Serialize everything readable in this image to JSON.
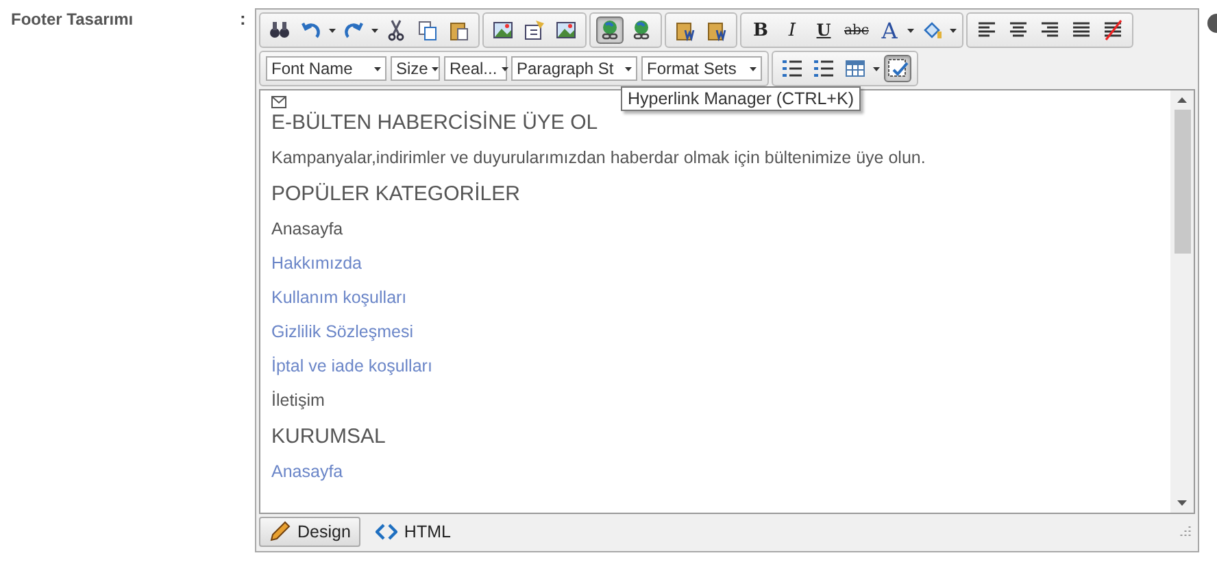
{
  "field_label": "Footer Tasarımı",
  "separator": ":",
  "toolbar_row1": [
    {
      "buttons": [
        {
          "kind": "find",
          "active": false
        },
        {
          "kind": "undo",
          "active": false
        },
        {
          "kind": "caret"
        },
        {
          "kind": "redo",
          "active": false
        },
        {
          "kind": "caret"
        },
        {
          "kind": "cut",
          "active": false
        },
        {
          "kind": "copy",
          "active": false
        },
        {
          "kind": "paste",
          "active": false
        }
      ]
    },
    {
      "buttons": [
        {
          "kind": "image",
          "active": false
        },
        {
          "kind": "properties",
          "active": false
        },
        {
          "kind": "image-map",
          "active": false
        }
      ]
    },
    {
      "buttons": [
        {
          "kind": "link",
          "active": true
        },
        {
          "kind": "unlink",
          "active": false
        }
      ]
    },
    {
      "buttons": [
        {
          "kind": "paste-word",
          "active": false
        },
        {
          "kind": "paste-word",
          "active": false
        }
      ]
    },
    {
      "buttons": [
        {
          "kind": "text",
          "label": "B",
          "active": false
        },
        {
          "kind": "text",
          "label": "I",
          "active": false
        },
        {
          "kind": "text",
          "label": "U",
          "active": false
        },
        {
          "kind": "text",
          "label": "abc",
          "active": false
        },
        {
          "kind": "text",
          "label": "A",
          "active": false
        },
        {
          "kind": "caret"
        },
        {
          "kind": "fill",
          "active": false
        },
        {
          "kind": "caret"
        }
      ]
    },
    {
      "buttons": [
        {
          "kind": "align-left",
          "active": false
        },
        {
          "kind": "align-center",
          "active": false
        },
        {
          "kind": "align-right",
          "active": false
        },
        {
          "kind": "justify",
          "active": false
        },
        {
          "kind": "clear",
          "active": false
        }
      ]
    }
  ],
  "toolbar_row2": {
    "dropdowns": [
      "Font Name",
      "Size",
      "Real...",
      "Paragraph St",
      "Format Sets"
    ],
    "buttons": [
      {
        "kind": "numbered-list",
        "active": false
      },
      {
        "kind": "bullet-list",
        "active": false
      },
      {
        "kind": "table",
        "active": false
      },
      {
        "kind": "caret"
      },
      {
        "kind": "check",
        "active": true
      }
    ]
  },
  "tooltip": "Hyperlink Manager (CTRL+K)",
  "content": [
    {
      "kind": "heading",
      "text": "E-BÜLTEN HABERCİSİNE ÜYE OL"
    },
    {
      "kind": "text",
      "text": "Kampanyalar,indirimler ve duyurularımızdan haberdar olmak için bültenimize üye olun."
    },
    {
      "kind": "heading",
      "text": "POPÜLER KATEGORİLER"
    },
    {
      "kind": "text",
      "text": "Anasayfa"
    },
    {
      "kind": "link",
      "text": "Hakkımızda"
    },
    {
      "kind": "link",
      "text": "Kullanım koşulları"
    },
    {
      "kind": "link",
      "text": "Gizlilik Sözleşmesi"
    },
    {
      "kind": "link",
      "text": "İptal ve iade koşulları"
    },
    {
      "kind": "text",
      "text": "İletişim"
    },
    {
      "kind": "heading",
      "text": "KURUMSAL"
    },
    {
      "kind": "link",
      "text": "Anasayfa"
    }
  ],
  "modes": [
    {
      "label": "Design",
      "selected": true
    },
    {
      "label": "HTML",
      "selected": false
    }
  ]
}
